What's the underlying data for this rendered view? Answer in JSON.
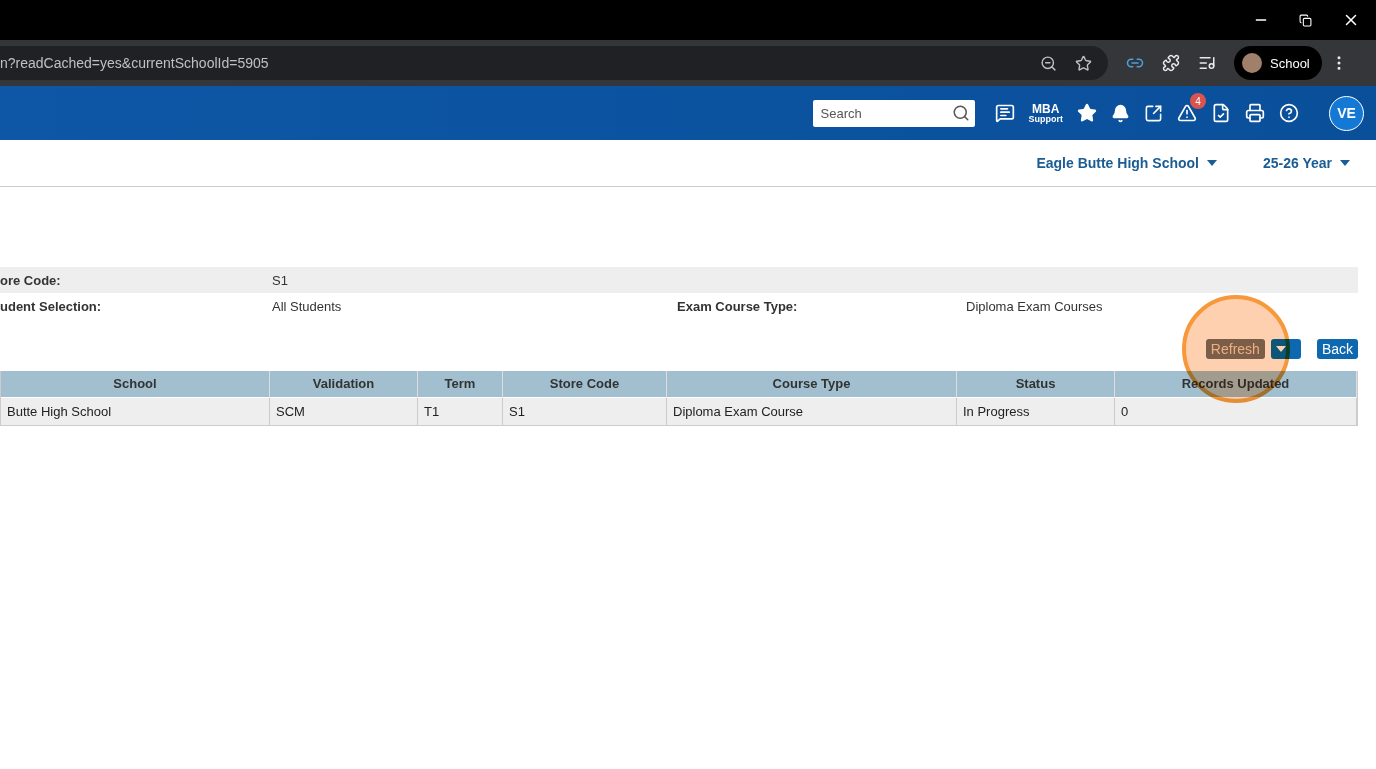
{
  "browser": {
    "url": "n?readCached=yes&currentSchoolId=5905",
    "profile": "School"
  },
  "header": {
    "search": {
      "placeholder": "Search"
    },
    "support": {
      "line1": "MBA",
      "line2": "Support"
    },
    "alert_count": "4",
    "avatar": "VE"
  },
  "subheader": {
    "school": "Eagle Butte High School",
    "year": "25-26 Year"
  },
  "info_rows": [
    {
      "shaded": true,
      "fields": [
        {
          "label": "ore Code:",
          "value": "S1"
        }
      ]
    },
    {
      "shaded": false,
      "fields": [
        {
          "label": "udent Selection:",
          "value": "All Students"
        },
        {
          "label": "Exam Course Type:",
          "value": "Diploma Exam Courses"
        }
      ]
    }
  ],
  "actions": {
    "refresh": "Refresh",
    "back": "Back"
  },
  "click_highlight": {
    "kind": "circle"
  },
  "table": {
    "columns": [
      "School",
      "Validation",
      "Term",
      "Store Code",
      "Course Type",
      "Status",
      "Records Updated"
    ],
    "rows": [
      [
        "Butte High School",
        "SCM",
        "T1",
        "S1",
        "Diploma Exam Course",
        "In Progress",
        "0"
      ]
    ]
  }
}
